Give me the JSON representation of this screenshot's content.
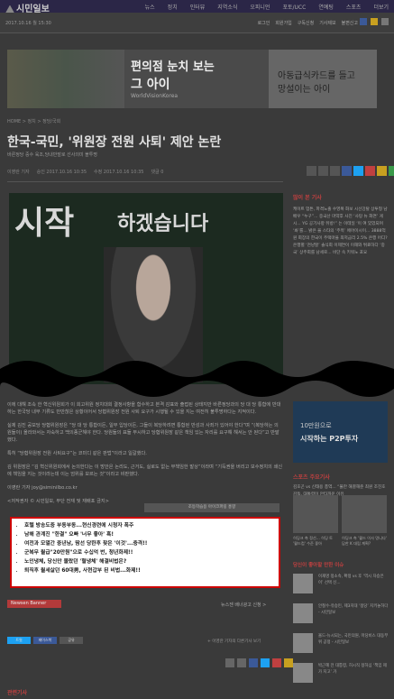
{
  "header": {
    "logo_text": "시민일보",
    "nav": [
      "뉴스",
      "정치",
      "인터뷰",
      "지역소식",
      "오피니언",
      "포토/UCC",
      "연예팅",
      "스포츠",
      "더보기"
    ]
  },
  "subbar": {
    "date": "2017.10.16 월 15:30",
    "links": [
      "로그인",
      "회원가입",
      "구독신청",
      "기사제보",
      "불편신고"
    ]
  },
  "ad": {
    "line1": "편의점 눈치 보는",
    "line2": "그 아이",
    "source": "WorldVisionKorea",
    "right_line1": "아동급식카드를 들고",
    "right_line2": "망설이는 아이"
  },
  "article": {
    "breadcrumb": "HOME > 정치 > 정당/국회",
    "title": "한국-국민, '위원장 전원 사퇴' 제안 논란",
    "subtitle": "바른정당 중수 육조,당내반발로 선사의미 볼투명",
    "meta": [
      "이영란 기자",
      "승인 2017.10.16 10:35",
      "수정 2017.10.16 10:35",
      "댓글 0"
    ],
    "photo_text1": "시작",
    "photo_text2": "하겠습니다",
    "paragraphs": [
      "이에 대해 조속 한 혁신위원회가 이 회고위원 정치대회 결정사항을 합수하고 본격 감표와 출접된 상태지만 바른정당과의 당 대 당 통합에 반대하는 한국당 내부 기류도 만만찮은 상황이어서 당협위원장 전원 사퇴 요구가 시행될 수 있을 지는 여전히 불투명하다는 지적이다.",
      "실제 김진 공보당 당협위원장은 “당 대 당 통합이든, 일부 입당이든, 그들이 복당하려면 통합된 반성과 사죄가 있어야 한다”며 “(복당하는 의원들이) 올라와서는 자숙하고 백의종군해야 한다. 당원들의 표들 무시하고 당협위원장 같은 책임 있는 자리를 요구해 해서는 안 된다”고 반발했다.",
      "특히 “당협위원장 전원 사퇴요구”는 코미디 같은 판법”이라고 일갈했다.",
      "김 위원장은 “김 혁신위원회에서 논의한다는 이 방안은 논리도, 근거도, 실로도 없는 무책임한 발상”이라며 “기득권을 버리고 보수정치의 쇄신에 책임을 지는 것이라는데 이는 엄위를 모르는 것”이라고 비판했다.",
      "이영란 기자  joy@siminilbo.co.kr",
      "<저작권자 © 시민일보, 무단 전재 및 재배포 금지>"
    ],
    "publisher_box": "조등학습용 아이코퍼링 홍향"
  },
  "related_links": [
    "호텔 방송도중 부동부동...현신경련에 시청자 폭주",
    "남해 관계진 \"한결\" 오빠 '너무 좋아' 흑!",
    "여전과 모멸간 중년남, 땀선 당한후 찾은 '이것'...충격!!",
    "군복무 월급\"20만원\"으로 수십억 번, 청년화제!!",
    "노인냉체, 당신만 몰랐던 '혈냉체' 해결비법은?",
    "퇴직후 월세살던 60대男, 사현갑부 된 비법...화제!!"
  ],
  "newsen": {
    "label": "Newsen Banner",
    "right_text": "뉴스젠 배너광고 신청 >"
  },
  "sns": [
    "트윗",
    "페이스북",
    "공유"
  ],
  "report_text": "+ 이영란 기자의 다른기사 보기",
  "related_title": "관련기사",
  "sidebar": {
    "popular_title": "많이 본 기사",
    "popular_text": "케이트 업튼, 파격노출 수영복 화보 시선강탈 상투형 남배우 “누구”... 중국산 마약후 사진 ‘사탕 뉴 화면’ 게시... YG 공기사항 뒤방!” 는 이테일 ‘이 여 있었되며 ‘봐’를... 밝은 을 스타의 ‘주목’ 에어이시이... 3888억원 회장의 한국이 주택마을 최저금리 2.5% 은행 어디? 은행별 ‘천냥할’ 솔식회 이제연이 이해와 튀료하다 ‘중국’ 상주회를 남세로... 비단 속 키워노 포요",
    "ad_line1": "10만원으로",
    "ad_line2": "시작하는 P2P투자",
    "sports_title": "스포츠 주요기사",
    "sports_text": "김호곤 vs 신태용 총역... “불만 해결해준 최원 조진호 감독, 대통령이 안타까운 이유",
    "thumb_captions": [
      "히딩크 측 정선... 히딩 토 '월드컵' 수준 좋아",
      "히딩크 측 '월드 이사 멍니다' 답한 K 대립 계획?"
    ],
    "opinion_title": "당신이 좋아할 만한 이슈",
    "opinion_items": [
      "이재명 정소속, 확정 vs 후 ‘역시 자승은 이’ 선택 신...",
      "안철수-유승민, 제3지대 ‘정당’ 지키놓하다 - 시민일보",
      "올드-뉴시되는, 국민의원, 마당비스 대동부위 공정 - 시민일보",
      "박근혜 전 대통령, 허시직 정하심 ‘책임 제가 지고’ 가"
    ]
  },
  "colors": {
    "accent": "#c04040",
    "nav_bg": "#2b2647",
    "highlight_border": "#cc0000"
  }
}
